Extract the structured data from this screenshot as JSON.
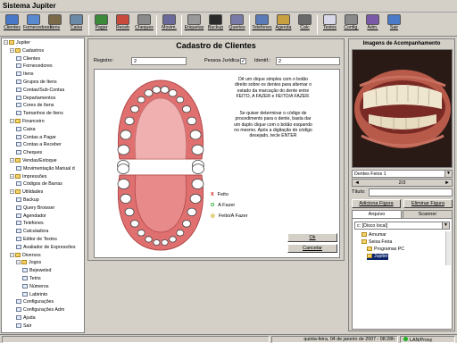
{
  "window": {
    "title": "Sistema Jupiter"
  },
  "toolbar": [
    {
      "label": "Clientes",
      "icon": "clients-icon",
      "color": "#4a78c8"
    },
    {
      "label": "Fornecedores",
      "icon": "suppliers-icon",
      "color": "#5a8ad0"
    },
    {
      "label": "Itens",
      "icon": "items-icon",
      "color": "#7a6a4a"
    },
    {
      "label": "Caixa",
      "icon": "cash-register-icon",
      "color": "#6a8aa8"
    },
    {
      "label": "Pagar",
      "icon": "pay-icon",
      "color": "#3a8a3a"
    },
    {
      "label": "Receb",
      "icon": "receive-icon",
      "color": "#c84a3a"
    },
    {
      "label": "Cheques",
      "icon": "cheques-icon",
      "color": "#8a8a8a"
    },
    {
      "label": "Movim.",
      "icon": "movement-icon",
      "color": "#6a6a9a"
    },
    {
      "label": "Etiquetas",
      "icon": "labels-icon",
      "color": "#9a9a9a"
    },
    {
      "label": "Backup",
      "icon": "backup-icon",
      "color": "#2a2a2a"
    },
    {
      "label": "Queries",
      "icon": "queries-icon",
      "color": "#7a7aa8"
    },
    {
      "label": "Telefones",
      "icon": "phones-icon",
      "color": "#5a7ab8"
    },
    {
      "label": "Agenda",
      "icon": "agenda-icon",
      "color": "#c8a040"
    },
    {
      "label": "Calc",
      "icon": "calculator-icon",
      "color": "#6a6a6a"
    },
    {
      "label": "Textos",
      "icon": "texts-icon",
      "color": "#d8d8e8"
    },
    {
      "label": "Config.",
      "icon": "config-icon",
      "color": "#8a8a8a"
    },
    {
      "label": "Adm.",
      "icon": "admin-icon",
      "color": "#7a5aa8"
    },
    {
      "label": "Sair",
      "icon": "exit-icon",
      "color": "#4a7ac8"
    }
  ],
  "tree": [
    {
      "label": "Jupiter",
      "level": 0,
      "type": "folder",
      "expander": "−"
    },
    {
      "label": "Cadastros",
      "level": 1,
      "type": "folder",
      "expander": "−"
    },
    {
      "label": "Clientes",
      "level": 2,
      "type": "doc"
    },
    {
      "label": "Fornecedores",
      "level": 2,
      "type": "doc"
    },
    {
      "label": "Itens",
      "level": 2,
      "type": "doc"
    },
    {
      "label": "Grupos de Itens",
      "level": 2,
      "type": "doc"
    },
    {
      "label": "Contas/Sub-Contas",
      "level": 2,
      "type": "doc"
    },
    {
      "label": "Departamentos",
      "level": 2,
      "type": "doc"
    },
    {
      "label": "Cores de Itens",
      "level": 2,
      "type": "doc"
    },
    {
      "label": "Tamanhos de Itens",
      "level": 2,
      "type": "doc"
    },
    {
      "label": "Financeiro",
      "level": 1,
      "type": "folder",
      "expander": "−"
    },
    {
      "label": "Caixa",
      "level": 2,
      "type": "doc"
    },
    {
      "label": "Contas a Pagar",
      "level": 2,
      "type": "doc"
    },
    {
      "label": "Contas a Receber",
      "level": 2,
      "type": "doc"
    },
    {
      "label": "Cheques",
      "level": 2,
      "type": "doc"
    },
    {
      "label": "Vendas/Estoque",
      "level": 1,
      "type": "folder",
      "expander": "−"
    },
    {
      "label": "Movimentação Manual d",
      "level": 2,
      "type": "doc"
    },
    {
      "label": "Impressões",
      "level": 1,
      "type": "folder",
      "expander": "−"
    },
    {
      "label": "Códigos de Barras",
      "level": 2,
      "type": "doc"
    },
    {
      "label": "Utilidades",
      "level": 1,
      "type": "folder",
      "expander": "−"
    },
    {
      "label": "Backup",
      "level": 2,
      "type": "doc"
    },
    {
      "label": "Query Browser",
      "level": 2,
      "type": "doc"
    },
    {
      "label": "Agendador",
      "level": 2,
      "type": "doc"
    },
    {
      "label": "Telefones",
      "level": 2,
      "type": "doc"
    },
    {
      "label": "Calculadora",
      "level": 2,
      "type": "doc"
    },
    {
      "label": "Editor de Textos",
      "level": 2,
      "type": "doc"
    },
    {
      "label": "Avaliador de Expressões",
      "level": 2,
      "type": "doc"
    },
    {
      "label": "Diversos",
      "level": 1,
      "type": "folder",
      "expander": "−"
    },
    {
      "label": "Jogos",
      "level": 2,
      "type": "folder",
      "expander": "−"
    },
    {
      "label": "Bejeweled",
      "level": 3,
      "type": "doc"
    },
    {
      "label": "Tetris",
      "level": 3,
      "type": "doc"
    },
    {
      "label": "Números",
      "level": 3,
      "type": "doc"
    },
    {
      "label": "Labirinto",
      "level": 3,
      "type": "doc"
    },
    {
      "label": "Configurações",
      "level": 2,
      "type": "doc"
    },
    {
      "label": "Configurações Adm",
      "level": 2,
      "type": "doc"
    },
    {
      "label": "Ajuda",
      "level": 2,
      "type": "doc"
    },
    {
      "label": "Sair",
      "level": 2,
      "type": "doc"
    }
  ],
  "form": {
    "title": "Cadastro de Clientes",
    "registro_label": "Registro:",
    "registro_value": "2",
    "pj_label": "Pessoa Jurídica",
    "pj_checked": "✓",
    "identif_label": "Identif.:",
    "identif_value": "2",
    "instructions_1": "Dê um clique simples com o botão direito sobre os dentes para alternar o estado da marcação do dente entre FEITO, A FAZER e FEITO/A FAZER.",
    "instructions_2": "Se quiser determinar o código de procedimento para o dente, basta dar um duplo clique com o botão esquerdo no mesmo. Após a digitação do código desejado, tecle ENTER",
    "legend": [
      {
        "symbol": "X",
        "label": "Feito",
        "color": "#d01010"
      },
      {
        "symbol": "O",
        "label": "A Fazer",
        "color": "#10a010"
      },
      {
        "symbol": "◎",
        "label": "Feito/A Fazer",
        "color": "#c8a000"
      }
    ],
    "ok_label": "Ok",
    "cancel_label": "Cancelar"
  },
  "right": {
    "header": "Imagens de Acompanhamento",
    "image_select": "Dentes Feios 1",
    "nav_counter": "2/3",
    "titulo_label": "Título:",
    "titulo_value": "",
    "add_button": "Adiciona Figura",
    "remove_button": "Eliminar Figura",
    "tabs": [
      "Arquivo",
      "Scanner"
    ],
    "drive": "c: [Disco local]",
    "folders": [
      {
        "label": "Arnumar",
        "level": 1
      },
      {
        "label": "Seixa Feira",
        "level": 1
      },
      {
        "label": "Programas PC",
        "level": 2
      },
      {
        "label": "Jupiter",
        "level": 2
      }
    ]
  },
  "status": {
    "datetime": "quinta-feira, 04 de janeiro de 2007 - 08:28h",
    "connection": "LAN/Proxy"
  }
}
